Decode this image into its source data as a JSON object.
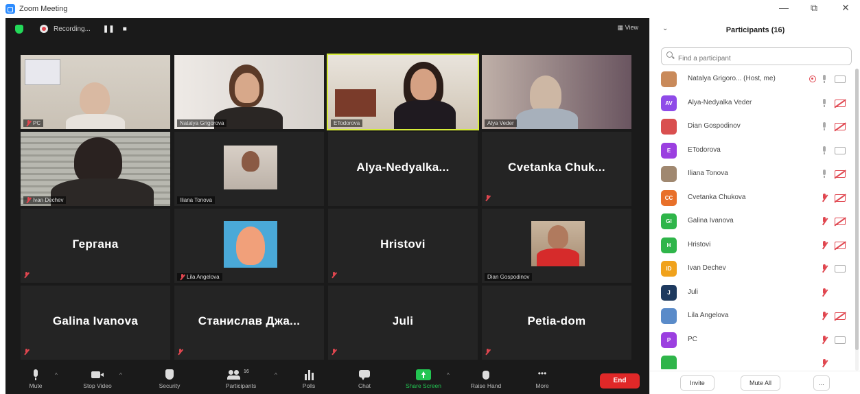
{
  "window": {
    "title": "Zoom Meeting",
    "controls": [
      "—",
      "⧉",
      "✕"
    ]
  },
  "topbar": {
    "recording_label": "Recording...",
    "pause_label": "❚❚",
    "stop_label": "■",
    "view_label": "View"
  },
  "tiles": [
    {
      "name": "PC"
    },
    {
      "name": "Natalya Grigorova"
    },
    {
      "name": "ETodorova"
    },
    {
      "name": "Alya Veder"
    },
    {
      "name": "Ivan Dechev"
    },
    {
      "name": "Iliana Tonova"
    },
    {
      "display": "Alya-Nedyalka..."
    },
    {
      "display": "Cvetanka Chuk..."
    },
    {
      "display": "Геpгана"
    },
    {
      "name": "Lila Angelova"
    },
    {
      "display": "Hristovi"
    },
    {
      "name": "Dian Gospodinov"
    },
    {
      "display": "Galina Ivanova"
    },
    {
      "display": "Станислав Джа..."
    },
    {
      "display": "Juli"
    },
    {
      "display": "Petia-dom"
    }
  ],
  "toolbar": {
    "mute": "Mute",
    "stop_video": "Stop Video",
    "security": "Security",
    "participants": "Participants",
    "participants_count": "16",
    "polls": "Polls",
    "chat": "Chat",
    "share_screen": "Share Screen",
    "raise_hand": "Raise Hand",
    "more": "More",
    "end": "End"
  },
  "panel": {
    "title": "Participants (16)",
    "search_placeholder": "Find a participant",
    "invite": "Invite",
    "mute_all": "Mute All",
    "more": "...",
    "participants": [
      {
        "name": "Natalya Grigoro... (Host, me)",
        "initials": "",
        "color": "#c98a5a",
        "mic": "on",
        "cam": "on",
        "recording": true
      },
      {
        "name": "Alya-Nedyalka Veder",
        "initials": "AV",
        "color": "#8f4be8",
        "mic": "on",
        "cam": "off"
      },
      {
        "name": "Dian Gospodinov",
        "initials": "",
        "color": "#d94f4f",
        "mic": "on",
        "cam": "off"
      },
      {
        "name": "ETodorova",
        "initials": "E",
        "color": "#9b3fe0",
        "mic": "on",
        "cam": "on"
      },
      {
        "name": "Iliana Tonova",
        "initials": "",
        "color": "#a08870",
        "mic": "on",
        "cam": "off"
      },
      {
        "name": "Cvetanka Chukova",
        "initials": "CC",
        "color": "#e8702a",
        "mic": "off",
        "cam": "off"
      },
      {
        "name": "Galina Ivanova",
        "initials": "GI",
        "color": "#2fb54a",
        "mic": "off",
        "cam": "off"
      },
      {
        "name": "Hristovi",
        "initials": "H",
        "color": "#2fb54a",
        "mic": "off",
        "cam": "off"
      },
      {
        "name": "Ivan Dechev",
        "initials": "ID",
        "color": "#f0a21c",
        "mic": "off",
        "cam": "on"
      },
      {
        "name": "Juli",
        "initials": "J",
        "color": "#1e3a5f",
        "mic": "off",
        "cam": "none"
      },
      {
        "name": "Lila Angelova",
        "initials": "",
        "color": "#5a8bc9",
        "mic": "off",
        "cam": "off"
      },
      {
        "name": "PC",
        "initials": "P",
        "color": "#9b3fe0",
        "mic": "off",
        "cam": "on"
      },
      {
        "name": "",
        "initials": "",
        "color": "#2fb54a",
        "mic": "off",
        "cam": "none"
      }
    ]
  }
}
